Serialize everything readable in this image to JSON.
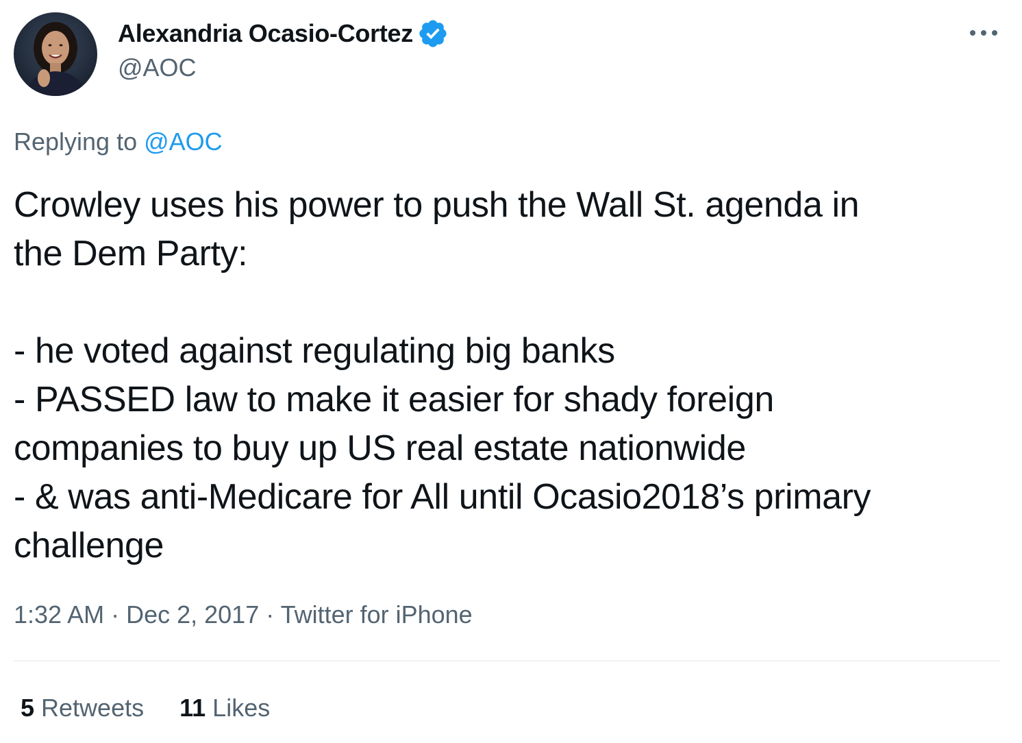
{
  "author": {
    "display_name": "Alexandria Ocasio-Cortez",
    "handle": "@AOC",
    "verified": true,
    "avatar_icon": "profile-photo",
    "verified_icon": "verified-badge-icon"
  },
  "reply": {
    "prefix": "Replying to ",
    "mention": "@AOC"
  },
  "tweet": {
    "text": "Crowley uses his power to push the Wall St. agenda in\nthe Dem Party:\n\n- he voted against regulating big banks\n- PASSED law to make it easier for shady foreign\ncompanies to buy up US real estate nationwide\n- & was anti-Medicare for All until Ocasio2018’s primary\nchallenge"
  },
  "meta": {
    "time": "1:32 AM",
    "separator": " · ",
    "date": "Dec 2, 2017",
    "source": "Twitter for iPhone"
  },
  "stats": {
    "retweets_count": "5",
    "retweets_label": " Retweets",
    "likes_count": "11",
    "likes_label": " Likes"
  },
  "colors": {
    "accent": "#1d9bf0",
    "secondary_text": "#536471",
    "primary_text": "#0f1419",
    "divider": "#eff3f4"
  },
  "icons": {
    "more": "more-options-icon"
  }
}
